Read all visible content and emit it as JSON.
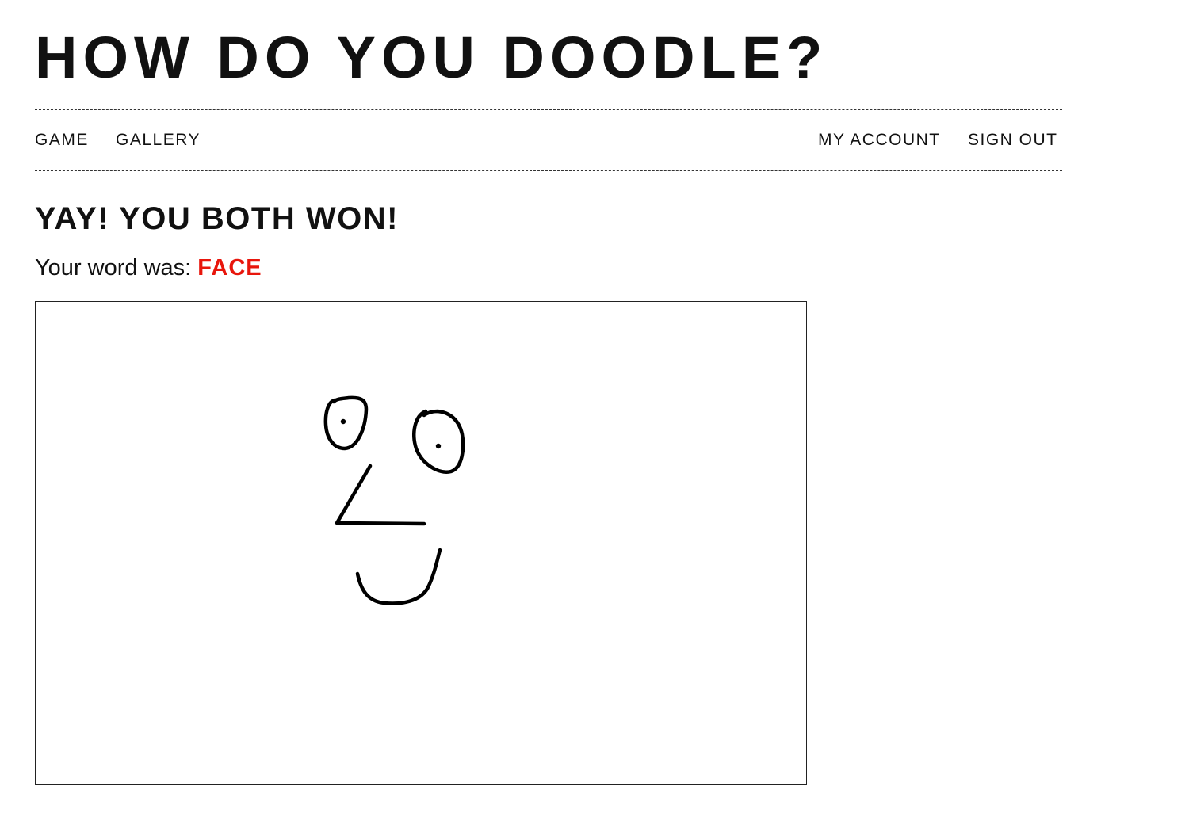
{
  "site": {
    "title": "HOW DO YOU DOODLE?"
  },
  "nav": {
    "game": "GAME",
    "gallery": "GALLERY",
    "my_account": "MY ACCOUNT",
    "sign_out": "SIGN OUT"
  },
  "result": {
    "heading": "YAY! YOU BOTH WON!",
    "word_prefix": "Your word was:",
    "word": "FACE"
  },
  "colors": {
    "text": "#111111",
    "accent": "#e8160c",
    "ink": "#000000"
  },
  "doodle": {
    "subject": "face drawing with two eyes, nose and smile"
  }
}
